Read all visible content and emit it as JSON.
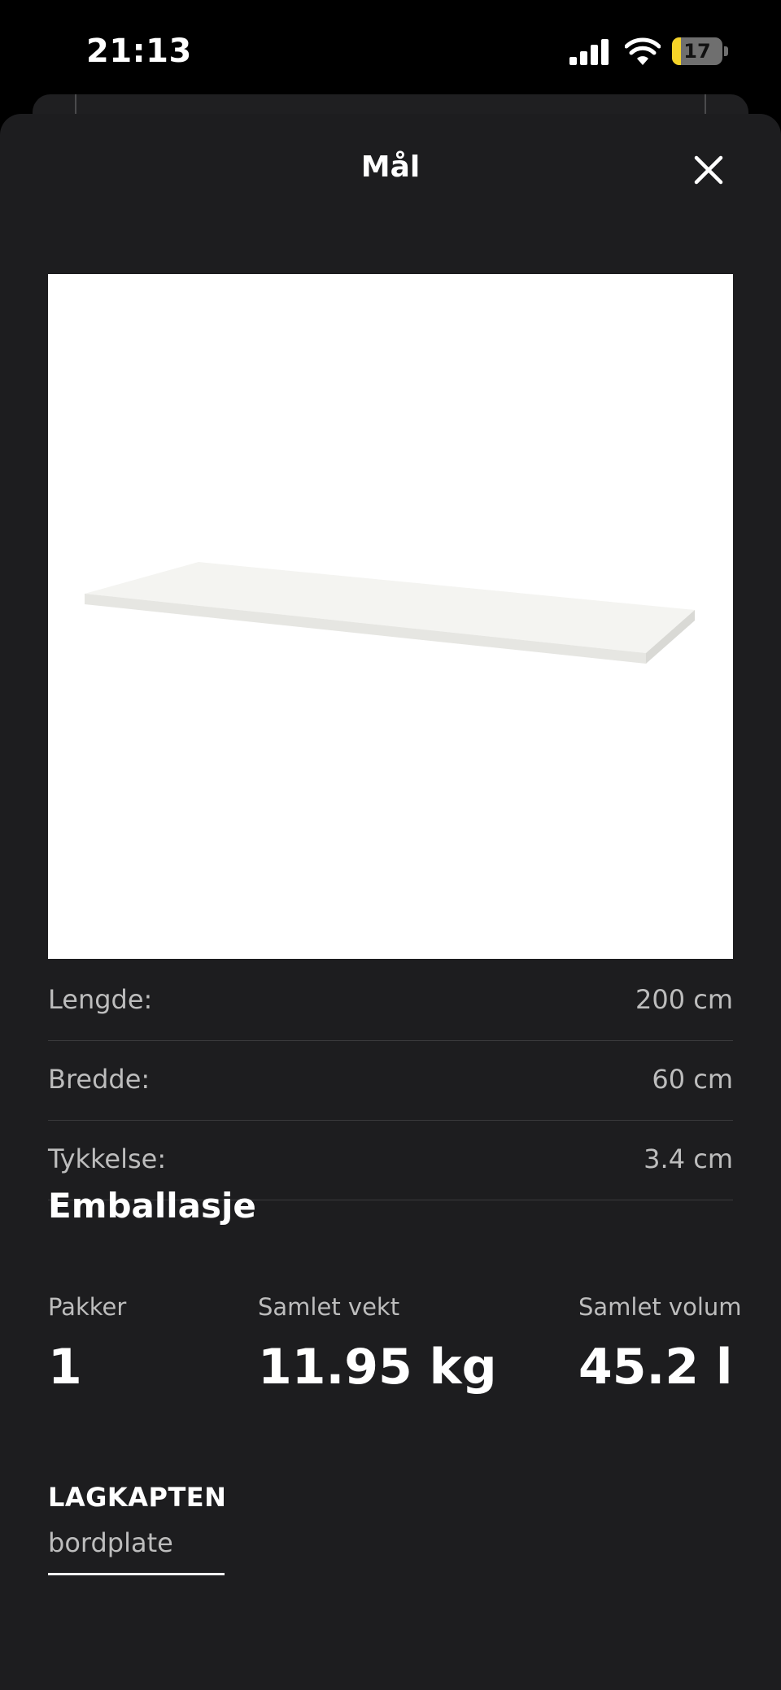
{
  "status": {
    "time": "21:13",
    "battery": "17",
    "battery_level": 0.17
  },
  "sheet": {
    "title": "Mål"
  },
  "dimensions": [
    {
      "label": "Lengde:",
      "value": "200 cm"
    },
    {
      "label": "Bredde:",
      "value": "60 cm"
    },
    {
      "label": "Tykkelse:",
      "value": "3.4 cm"
    }
  ],
  "packaging": {
    "heading": "Emballasje",
    "packages": {
      "label": "Pakker",
      "value": "1"
    },
    "weight": {
      "label": "Samlet vekt",
      "value": "11.95 kg"
    },
    "volume": {
      "label": "Samlet volum",
      "value": "45.2 l"
    }
  },
  "product": {
    "name": "LAGKAPTEN",
    "description": "bordplate"
  },
  "icons": {
    "close": "close-icon",
    "signal": "cellular-signal-icon",
    "wifi": "wifi-icon",
    "battery": "battery-icon"
  },
  "colors": {
    "background": "#1d1d1f",
    "text": "#ffffff",
    "secondary_text": "#bdbdbd",
    "battery_fill": "#f5d328"
  }
}
